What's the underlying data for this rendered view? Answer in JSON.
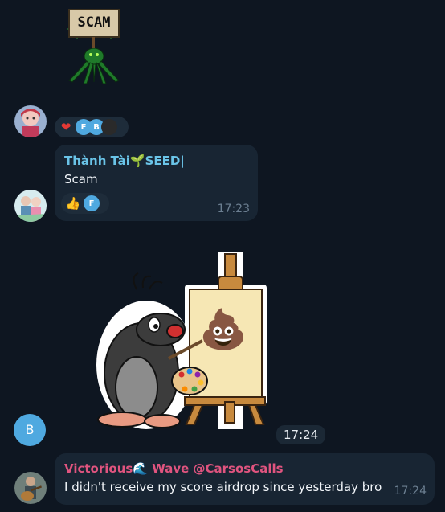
{
  "sticker_scam": {
    "sign_text": "SCAM"
  },
  "message1": {
    "sender": "Thành Tài🌱SEED|",
    "text": "Scam",
    "time": "17:23",
    "sender_color": "#6ac4e8"
  },
  "reactions_top": [
    {
      "icon": "heart-icon",
      "glyph": "❤"
    },
    {
      "icon": "avatar-f",
      "glyph": "F"
    },
    {
      "icon": "avatar-b",
      "glyph": "B"
    },
    {
      "icon": "avatar-dark",
      "glyph": ""
    }
  ],
  "reactions_msg1": [
    {
      "icon": "thumbs-up-icon",
      "glyph": "👍"
    },
    {
      "icon": "avatar-f",
      "glyph": "F"
    }
  ],
  "sticker_mole": {
    "time": "17:24",
    "poop_glyph": "💩"
  },
  "avatar_b": {
    "letter": "B",
    "color": "#4fa9e0"
  },
  "message2": {
    "sender": "Victorious🌊 Wave @CarsosCalls",
    "text": "I didn't receive my score airdrop since yesterday bro",
    "time": "17:24",
    "sender_color": "#e0547f"
  }
}
